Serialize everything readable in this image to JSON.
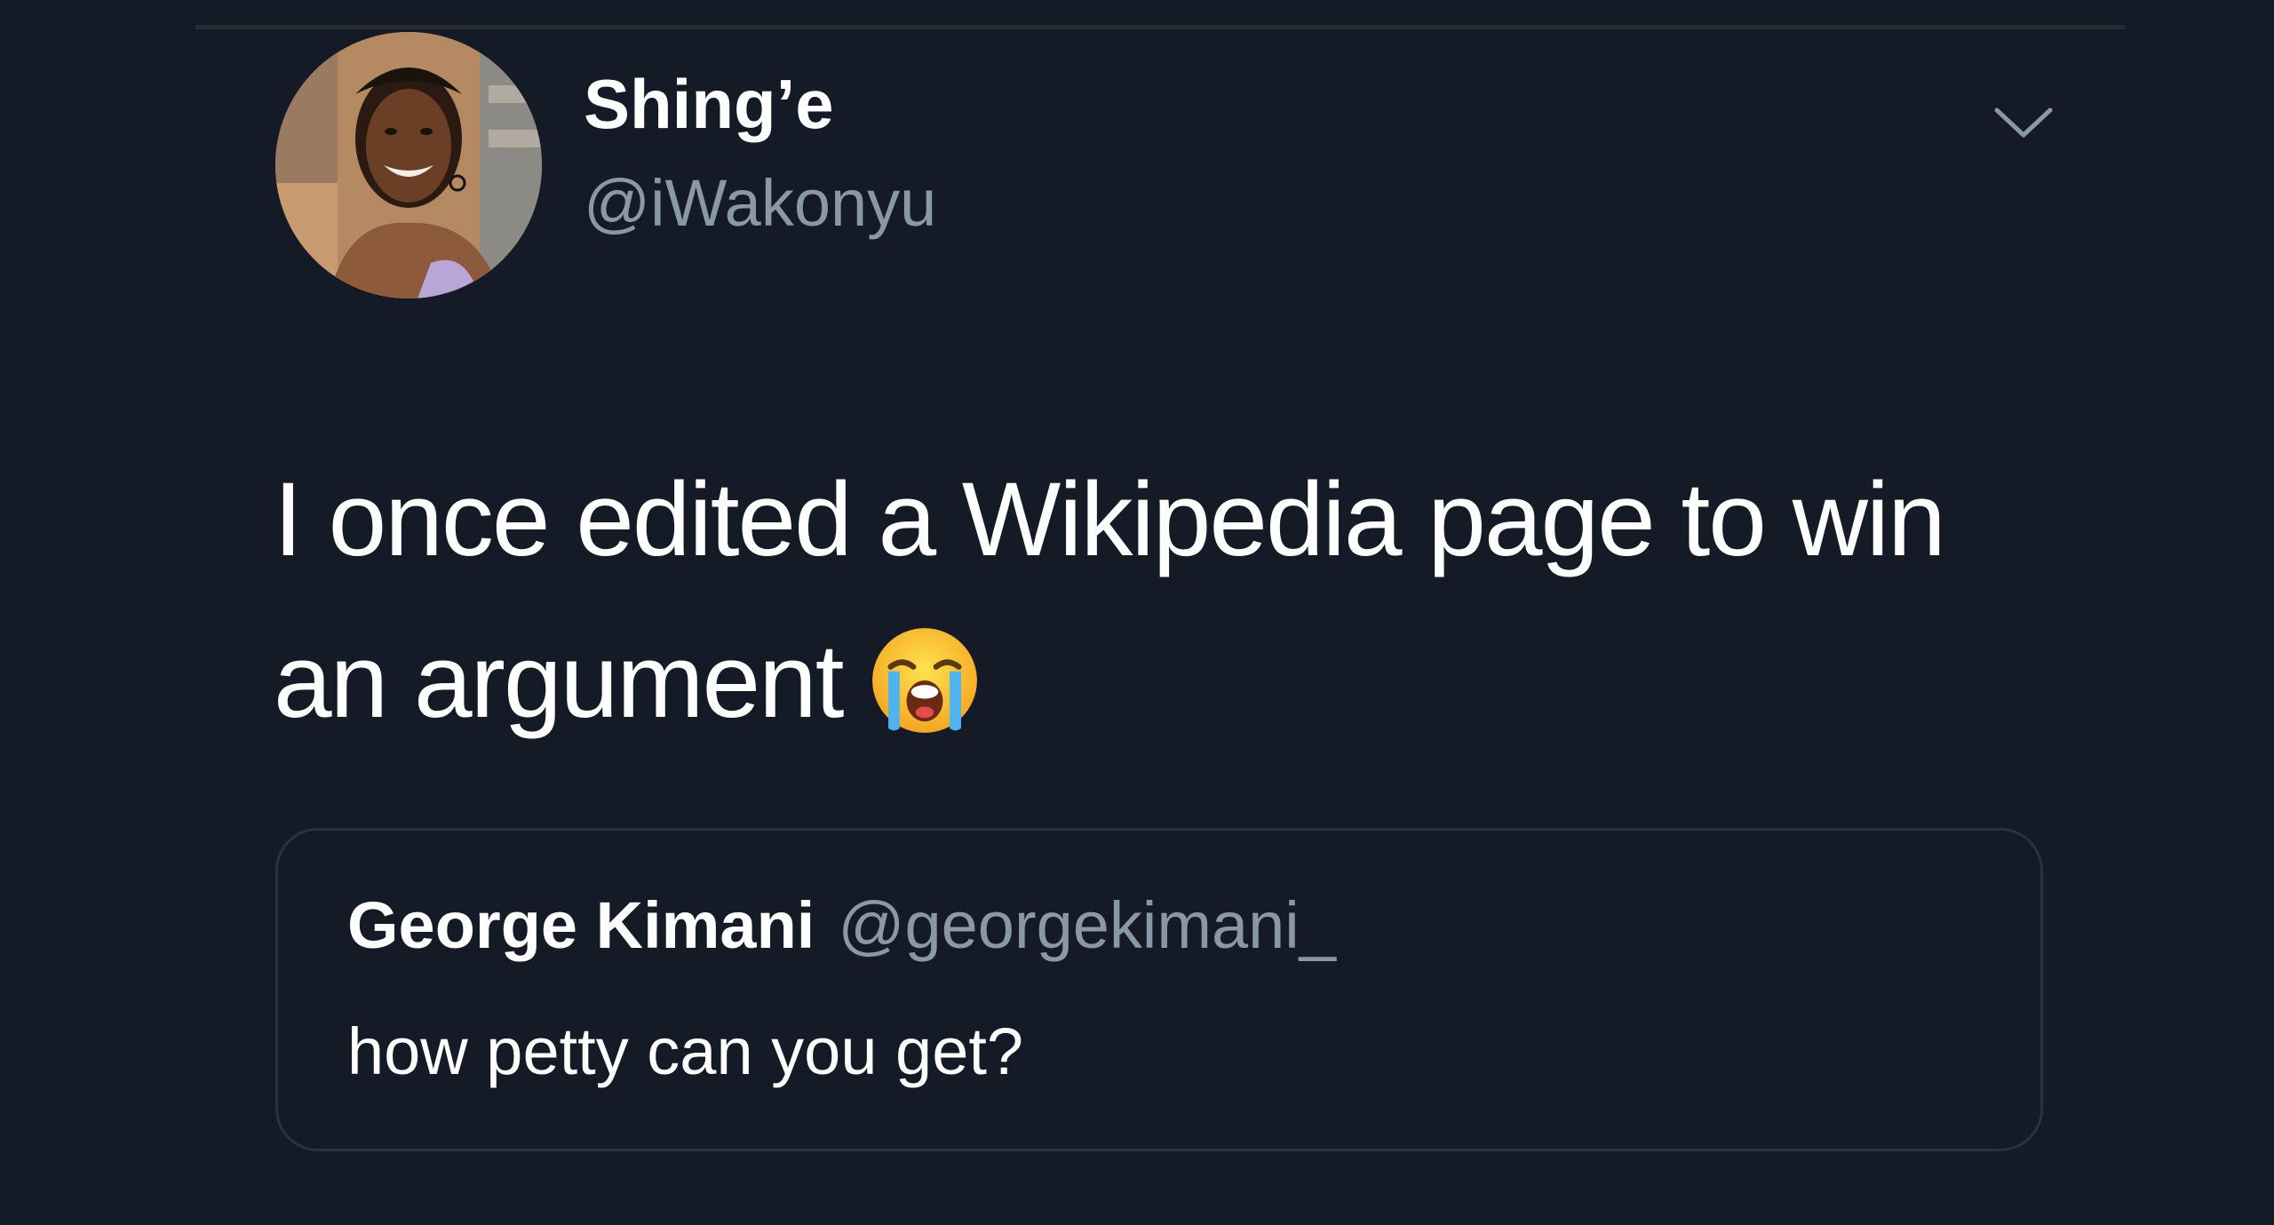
{
  "tweet": {
    "author": {
      "display_name": "Shing’e",
      "handle": "@iWakonyu",
      "avatar": "profile-photo"
    },
    "more_icon": "chevron-down-icon",
    "text_lines": [
      "I once edited a Wikipedia page to win",
      "an argument"
    ],
    "emoji": "loudly-crying-face-icon"
  },
  "quoted_tweet": {
    "display_name": "George Kimani",
    "handle": "@georgekimani_",
    "text": "how petty can you get?"
  },
  "colors": {
    "background": "#151b26",
    "primary_text": "#ffffff",
    "secondary_text": "#8898a7",
    "border": "#2b323d"
  }
}
